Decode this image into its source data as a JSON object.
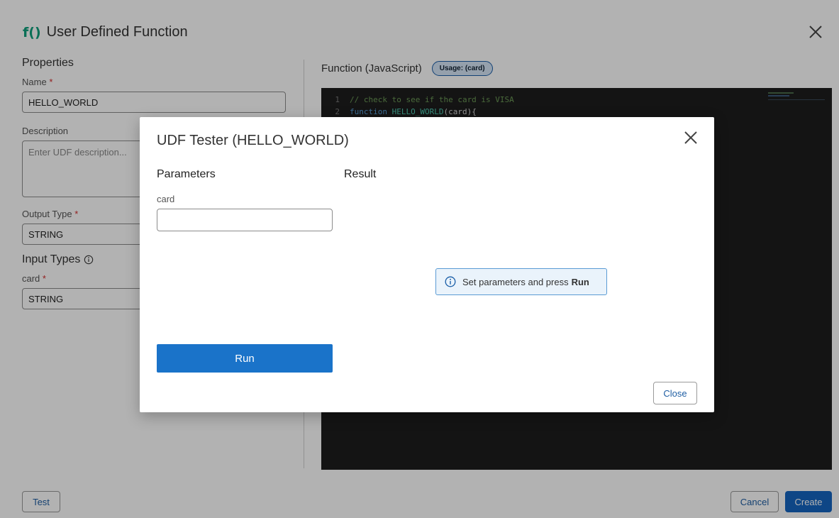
{
  "page": {
    "icon": "f()",
    "title": "User Defined Function",
    "properties_title": "Properties",
    "name_label": "Name",
    "name_value": "HELLO_WORLD",
    "description_label": "Description",
    "description_placeholder": "Enter UDF description...",
    "output_type_label": "Output Type",
    "output_type_value": "STRING",
    "input_types_title": "Input Types",
    "input_card_label": "card",
    "input_card_value": "STRING",
    "required_mark": "*",
    "function_title": "Function (JavaScript)",
    "usage_badge": "Usage: (card)",
    "code": [
      {
        "num": "1",
        "comment": "// check to see if the card is VISA"
      },
      {
        "num": "2",
        "kw": "function",
        "fname": "HELLO_WORLD",
        "rest": "(card){"
      }
    ],
    "test_label": "Test",
    "cancel_label": "Cancel",
    "create_label": "Create"
  },
  "modal": {
    "title": "UDF Tester (HELLO_WORLD)",
    "parameters_title": "Parameters",
    "result_title": "Result",
    "param_card_label": "card",
    "param_card_value": "",
    "info_text": "Set parameters and press",
    "info_bold": "Run",
    "run_label": "Run",
    "close_label": "Close"
  },
  "colors": {
    "primary": "#1a73c9",
    "accent_green": "#0d9f7c",
    "editor_bg": "#1e1e1e",
    "info_bg": "#eaf3fb"
  }
}
